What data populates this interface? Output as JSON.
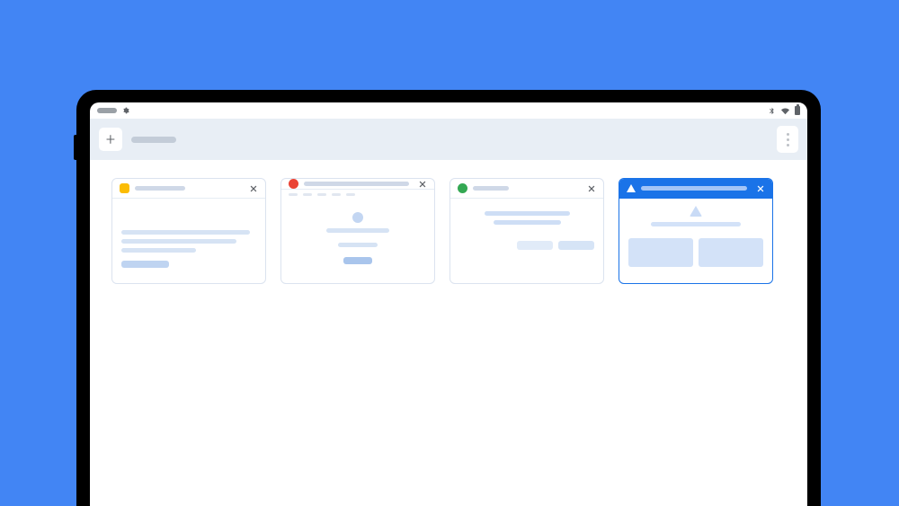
{
  "status_bar": {
    "left_icons": [
      "pill",
      "gear"
    ],
    "right_icons": [
      "bluetooth",
      "wifi",
      "battery"
    ]
  },
  "tab_strip": {
    "new_tab_glyph": "+",
    "placeholder_label": "",
    "menu_button": "more"
  },
  "cards": [
    {
      "favicon_color": "#fbbc04",
      "favicon_shape": "rounded",
      "title_placeholder": "",
      "body_type": "text-lines"
    },
    {
      "favicon_color": "#ea4335",
      "favicon_shape": "circle",
      "title_placeholder": "",
      "body_type": "profile"
    },
    {
      "favicon_color": "#34a853",
      "favicon_shape": "circle",
      "title_placeholder": "",
      "body_type": "centered-chips"
    },
    {
      "favicon_color": "#ffffff",
      "favicon_shape": "triangle",
      "title_placeholder": "",
      "body_type": "alert",
      "active": true
    }
  ],
  "colors": {
    "background": "#4285f4",
    "accent": "#1a73e8"
  }
}
